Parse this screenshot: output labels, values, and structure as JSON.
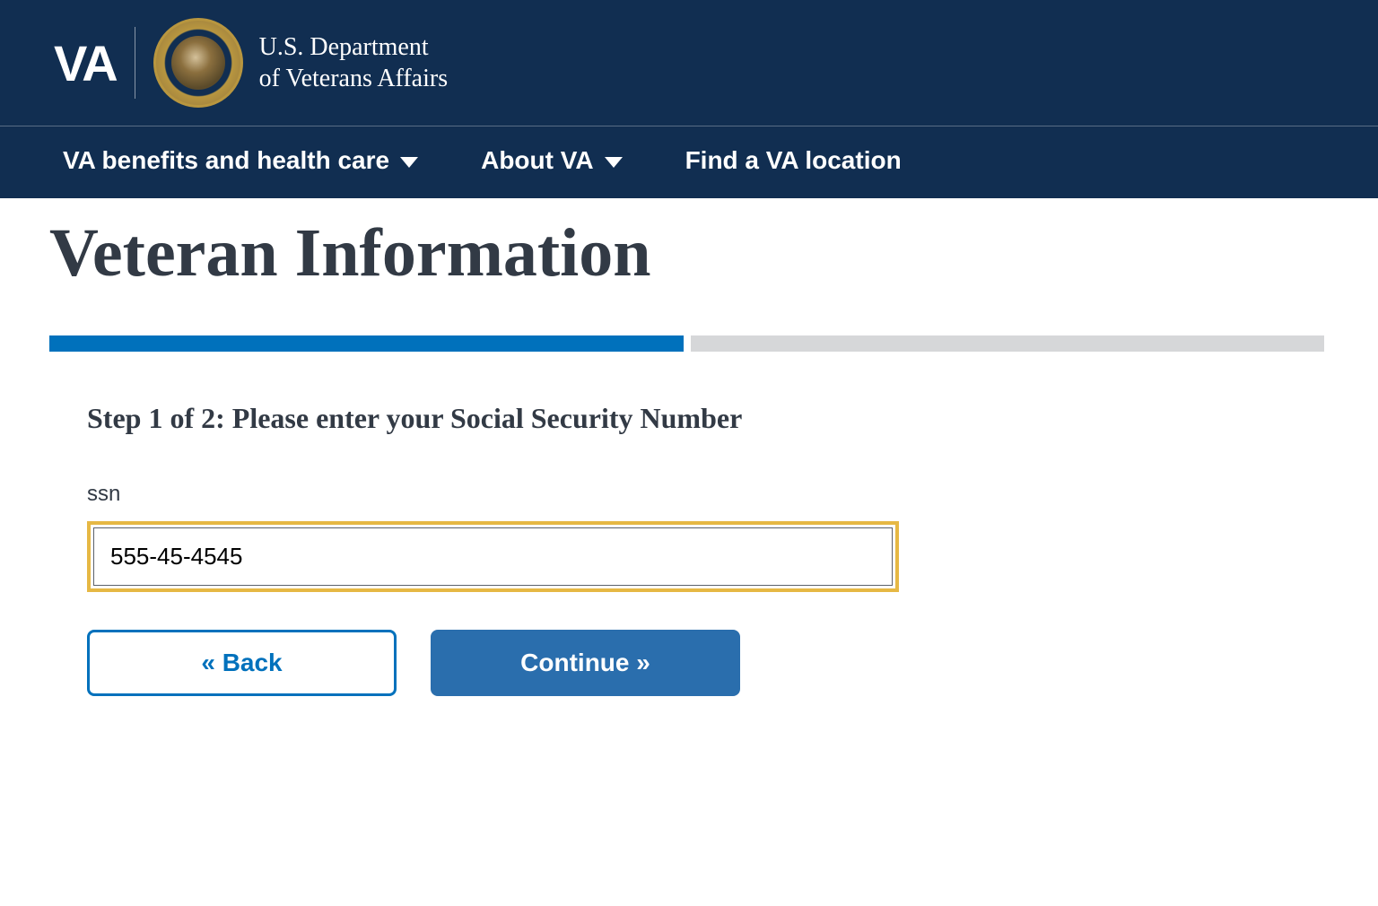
{
  "header": {
    "logo_text": "VA",
    "dept_line1": "U.S. Department",
    "dept_line2": "of Veterans Affairs"
  },
  "nav": {
    "items": [
      {
        "label": "VA benefits and health care",
        "has_dropdown": true
      },
      {
        "label": "About VA",
        "has_dropdown": true
      },
      {
        "label": "Find a VA location",
        "has_dropdown": false
      }
    ]
  },
  "page": {
    "title": "Veteran Information",
    "step_heading": "Step 1 of 2: Please enter your Social Security Number",
    "progress": {
      "current": 1,
      "total": 2
    }
  },
  "form": {
    "ssn_label": "ssn",
    "ssn_value": "555-45-4545"
  },
  "buttons": {
    "back": "« Back",
    "continue": "Continue »"
  }
}
